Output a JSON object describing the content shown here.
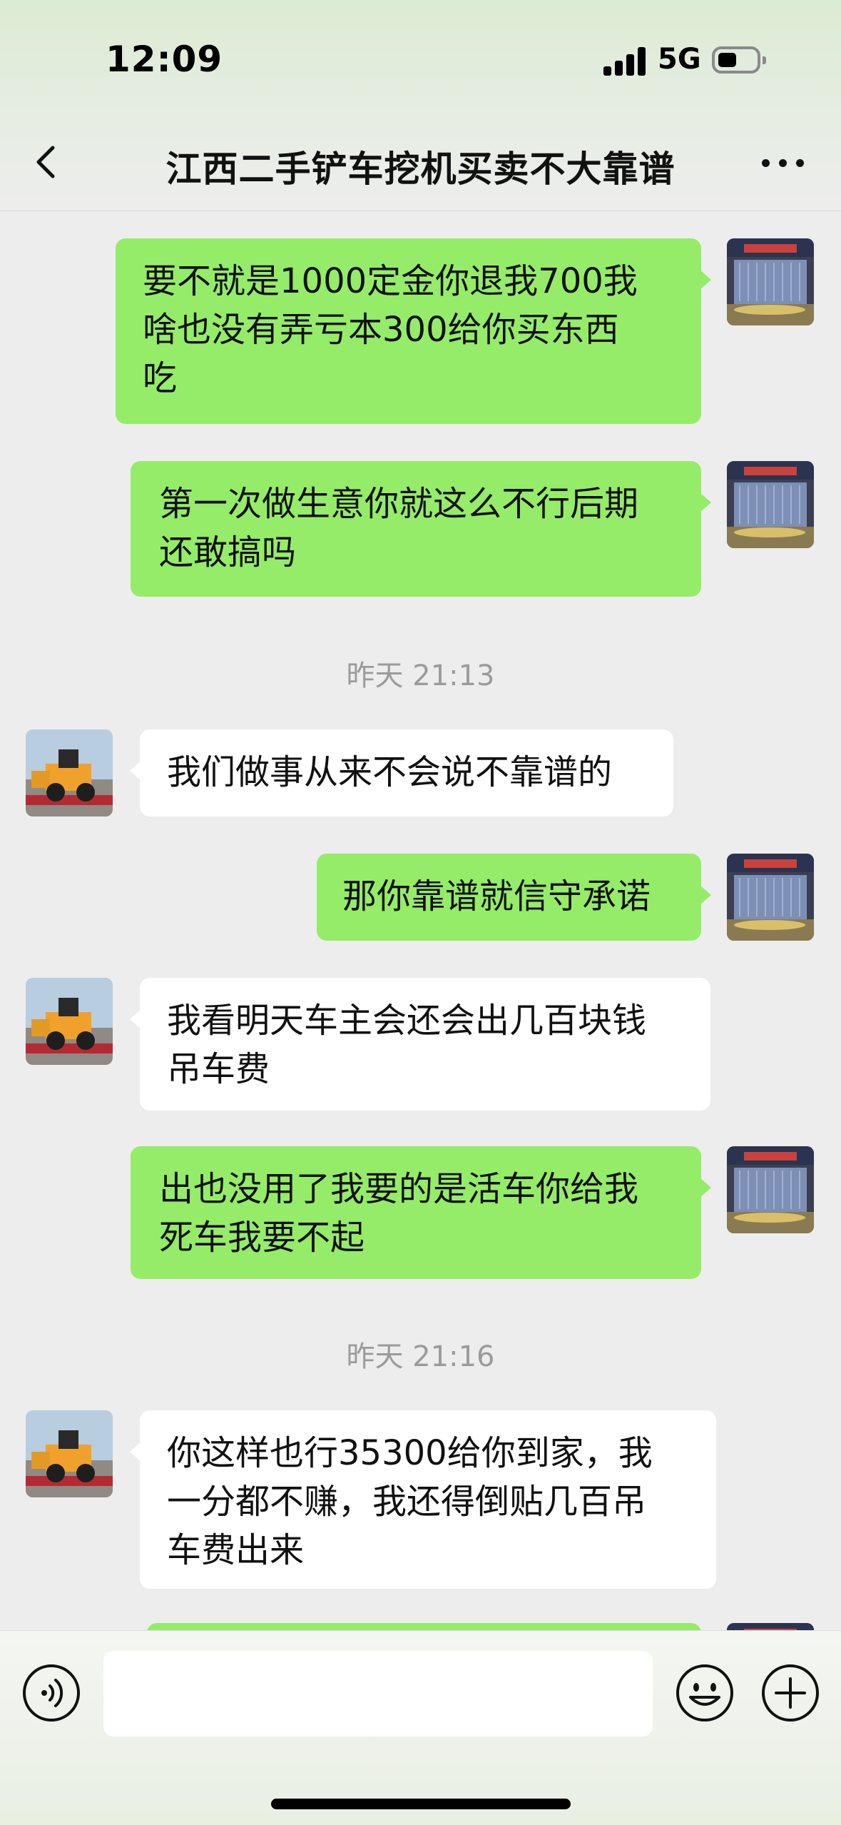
{
  "status_bar": {
    "time": "12:09",
    "network": "5G"
  },
  "header": {
    "title": "江西二手铲车挖机买卖不大靠谱"
  },
  "messages": [
    {
      "lines": [
        "要不就是1000定金你退我700我",
        "啥也没有弄亏本300给你买东西",
        "吃"
      ]
    },
    {
      "lines": [
        "第一次做生意你就这么不行后期",
        "还敢搞吗"
      ]
    },
    {
      "timestamp": "昨天 21:13"
    },
    {
      "lines": [
        "我们做事从来不会说不靠谱的"
      ]
    },
    {
      "lines": [
        "那你靠谱就信守承诺"
      ]
    },
    {
      "lines": [
        "我看明天车主会还会出几百块钱",
        "吊车费"
      ]
    },
    {
      "lines": [
        "出也没用了我要的是活车你给我",
        "死车我要不起"
      ]
    },
    {
      "timestamp": "昨天 21:16"
    },
    {
      "lines": [
        "你这样也行35300给你到家，我",
        "一分都不赚，我还得倒贴几百吊",
        "车费出来"
      ]
    }
  ]
}
